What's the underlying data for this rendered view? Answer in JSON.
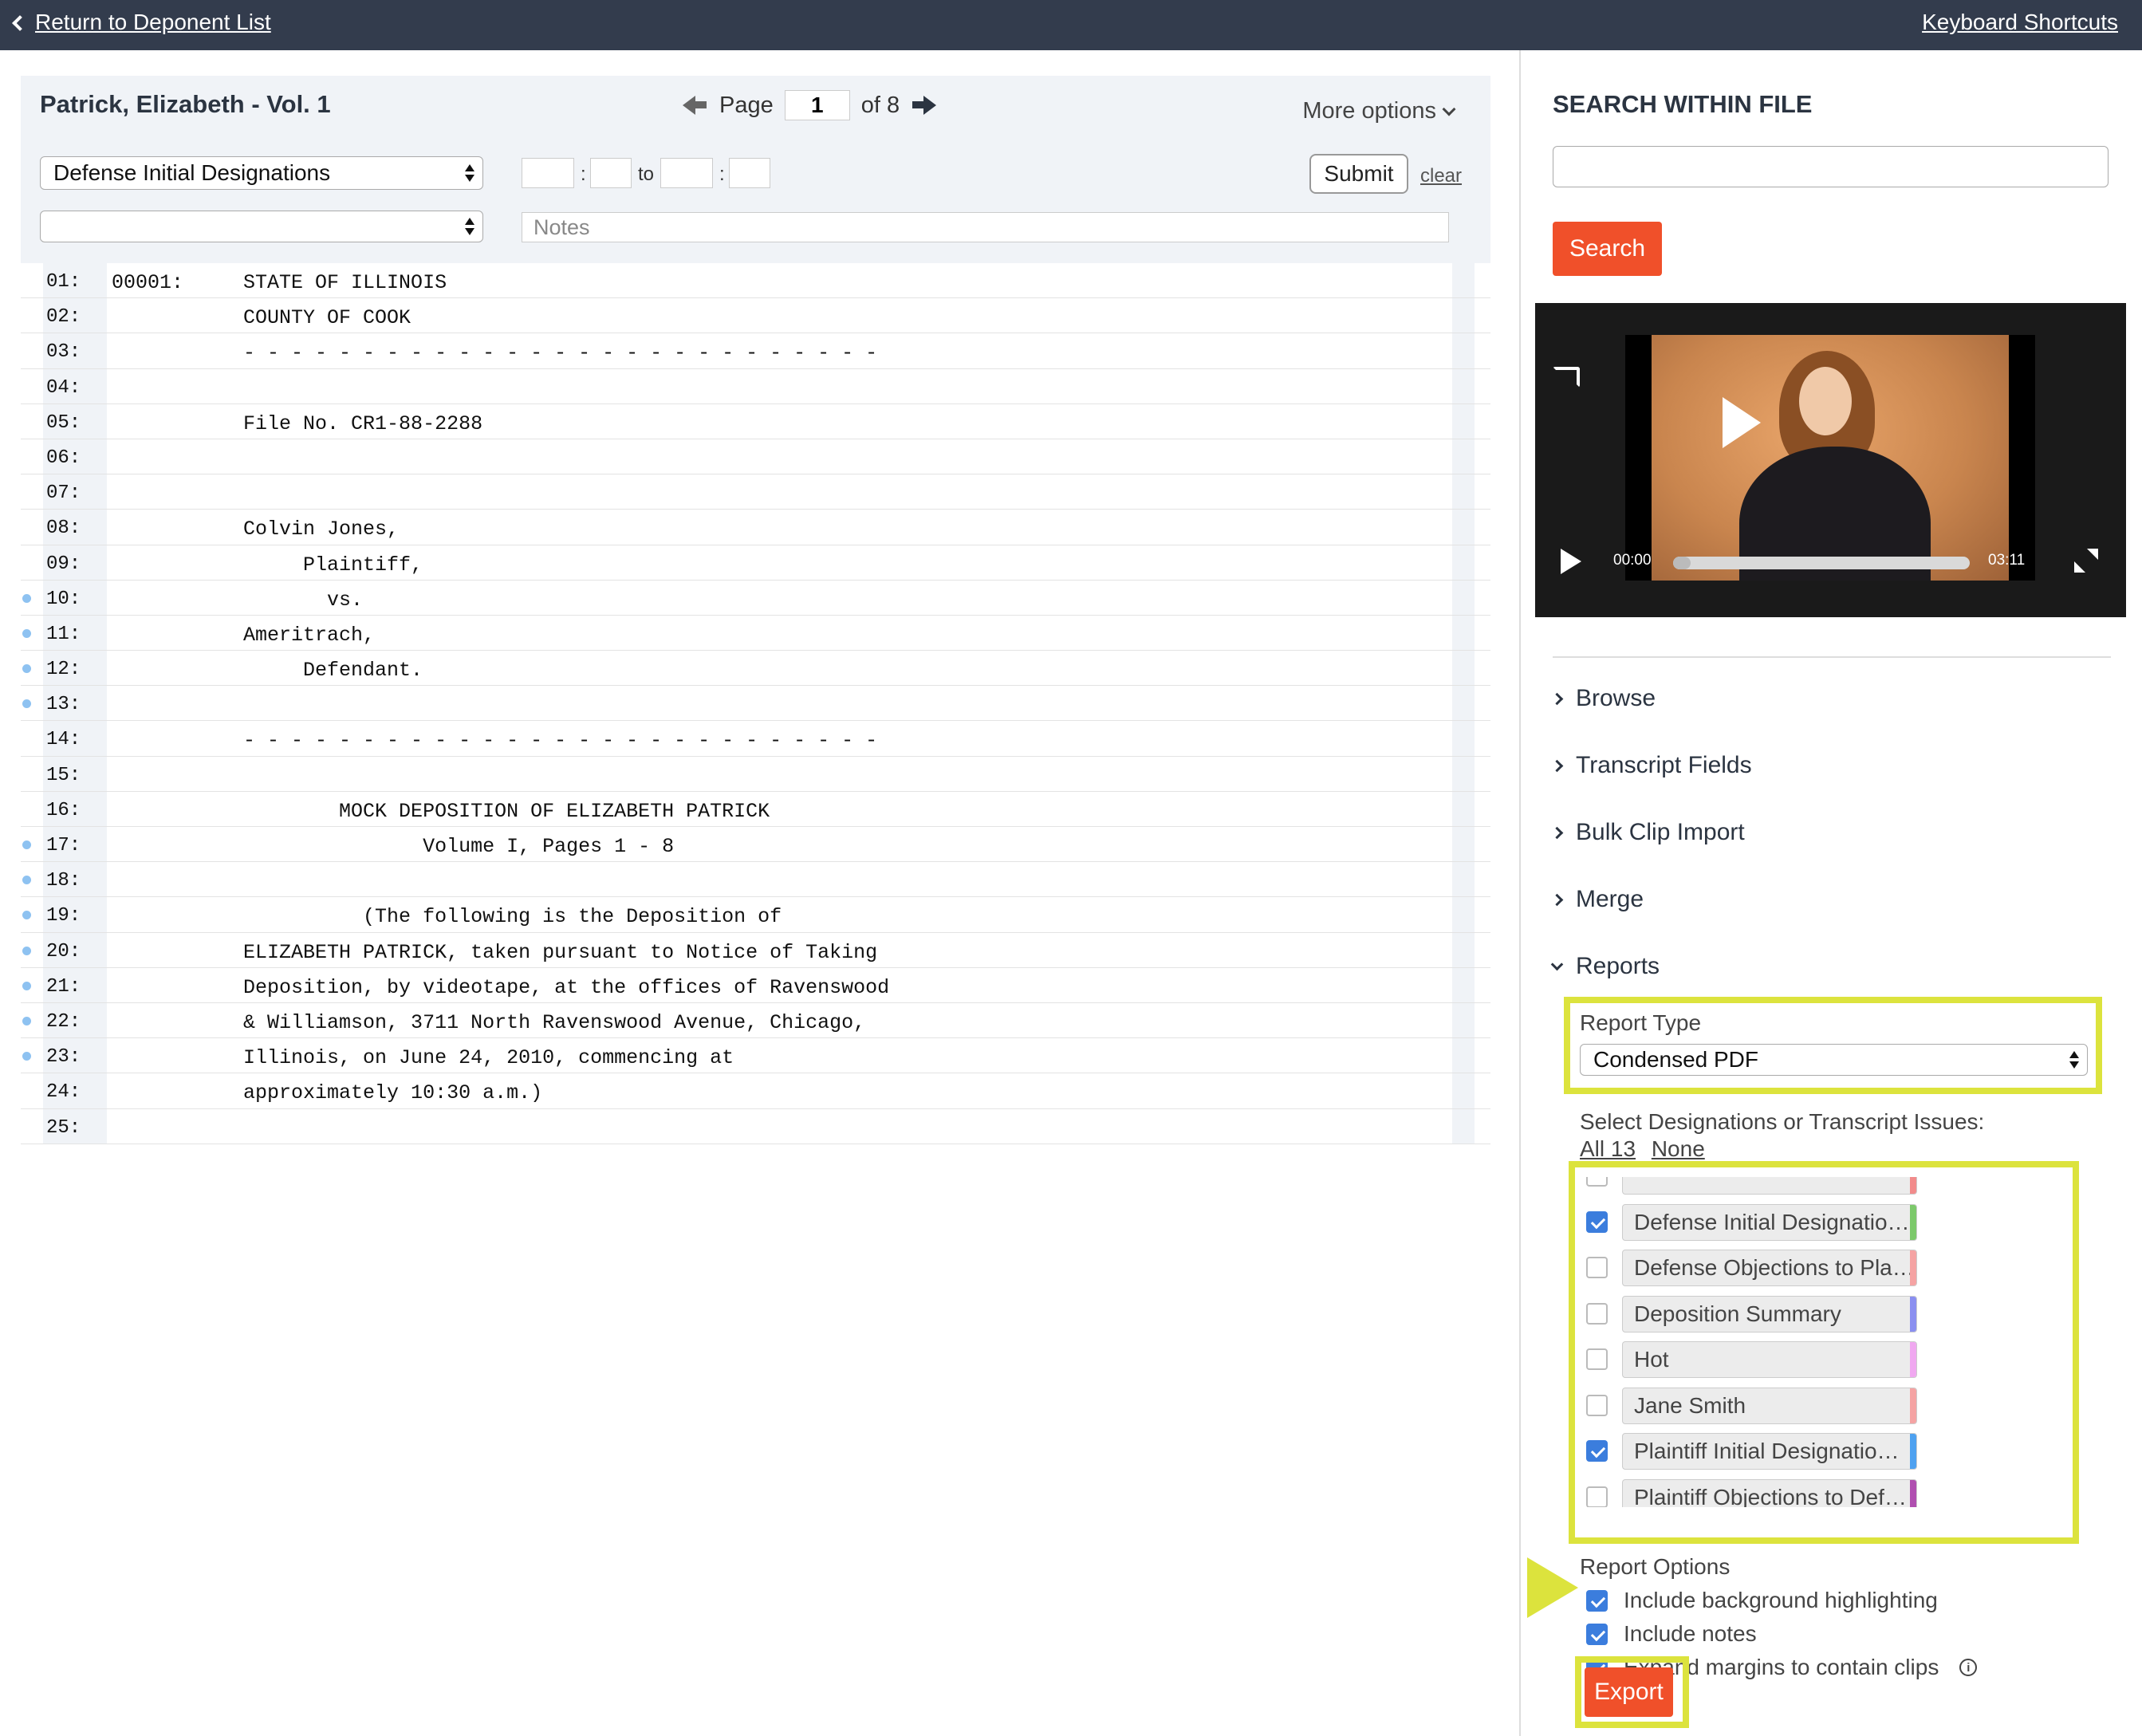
{
  "topbar": {
    "back_label": "Return to Deponent List",
    "keyboard_shortcuts": "Keyboard Shortcuts"
  },
  "viewer": {
    "title": "Patrick, Elizabeth - Vol. 1",
    "page_label": "Page",
    "page_value": "1",
    "page_of": "of 8",
    "more_options": "More options",
    "designation_select": "Defense Initial Designations",
    "second_select": "",
    "time_to": "to",
    "time_colon": ":",
    "submit_label": "Submit",
    "clear_label": "clear",
    "notes_placeholder": "Notes"
  },
  "transcript": {
    "lines": [
      {
        "num": "01:",
        "text": "00001:     STATE OF ILLINOIS",
        "dot": false
      },
      {
        "num": "02:",
        "text": "           COUNTY OF COOK",
        "dot": false
      },
      {
        "num": "03:",
        "text": "           - - - - - - - - - - - - - - - - - - - - - - - - - - -",
        "dot": false
      },
      {
        "num": "04:",
        "text": "",
        "dot": false
      },
      {
        "num": "05:",
        "text": "           File No. CR1-88-2288",
        "dot": false
      },
      {
        "num": "06:",
        "text": "",
        "dot": false
      },
      {
        "num": "07:",
        "text": "",
        "dot": false
      },
      {
        "num": "08:",
        "text": "           Colvin Jones,",
        "dot": false
      },
      {
        "num": "09:",
        "text": "                Plaintiff,",
        "dot": false
      },
      {
        "num": "10:",
        "text": "                  vs.",
        "dot": true
      },
      {
        "num": "11:",
        "text": "           Ameritrach,",
        "dot": true
      },
      {
        "num": "12:",
        "text": "                Defendant.",
        "dot": true
      },
      {
        "num": "13:",
        "text": "",
        "dot": true
      },
      {
        "num": "14:",
        "text": "           - - - - - - - - - - - - - - - - - - - - - - - - - - -",
        "dot": false
      },
      {
        "num": "15:",
        "text": "",
        "dot": false
      },
      {
        "num": "16:",
        "text": "                   MOCK DEPOSITION OF ELIZABETH PATRICK",
        "dot": false
      },
      {
        "num": "17:",
        "text": "                          Volume I, Pages 1 - 8",
        "dot": true
      },
      {
        "num": "18:",
        "text": "",
        "dot": true
      },
      {
        "num": "19:",
        "text": "                     (The following is the Deposition of",
        "dot": true
      },
      {
        "num": "20:",
        "text": "           ELIZABETH PATRICK, taken pursuant to Notice of Taking",
        "dot": true
      },
      {
        "num": "21:",
        "text": "           Deposition, by videotape, at the offices of Ravenswood",
        "dot": true
      },
      {
        "num": "22:",
        "text": "           & Williamson, 3711 North Ravenswood Avenue, Chicago,",
        "dot": true
      },
      {
        "num": "23:",
        "text": "           Illinois, on June 24, 2010, commencing at",
        "dot": true
      },
      {
        "num": "24:",
        "text": "           approximately 10:30 a.m.)",
        "dot": false
      },
      {
        "num": "25:",
        "text": "",
        "dot": false
      }
    ]
  },
  "sidebar": {
    "search_title": "SEARCH WITHIN FILE",
    "search_value": "",
    "search_button": "Search",
    "video": {
      "current_time": "00:00",
      "duration": "03:11",
      "progress": 0
    },
    "accordion": [
      "Browse",
      "Transcript Fields",
      "Bulk Clip Import",
      "Merge",
      "Reports"
    ],
    "reports": {
      "report_type_label": "Report Type",
      "report_type_value": "Condensed PDF",
      "select_label": "Select Designations or Transcript Issues:",
      "all_label": "All 13",
      "none_label": "None",
      "designations": [
        {
          "label": "",
          "checked": false,
          "color": "#f28b8b"
        },
        {
          "label": "Defense Initial Designatio…",
          "checked": true,
          "color": "#7cc96b"
        },
        {
          "label": "Defense Objections to Pla…",
          "checked": false,
          "color": "#f5a3a3"
        },
        {
          "label": "Deposition Summary",
          "checked": false,
          "color": "#8a8ff0"
        },
        {
          "label": "Hot",
          "checked": false,
          "color": "#f0a8f0"
        },
        {
          "label": "Jane Smith",
          "checked": false,
          "color": "#f5a3a3"
        },
        {
          "label": "Plaintiff Initial Designatio…",
          "checked": true,
          "color": "#4ea1f0"
        },
        {
          "label": "Plaintiff Objections to Def…",
          "checked": false,
          "color": "#b04fb0"
        }
      ],
      "options_label": "Report Options",
      "options": [
        {
          "label": "Include background highlighting",
          "checked": true
        },
        {
          "label": "Include notes",
          "checked": true
        },
        {
          "label": "Expand margins to contain clips",
          "checked": true
        }
      ],
      "export_label": "Export"
    }
  },
  "colors": {
    "topbar": "#333c4d",
    "accent": "#f0502a",
    "highlight": "#dce33d",
    "checkbox": "#3b7ddd"
  }
}
